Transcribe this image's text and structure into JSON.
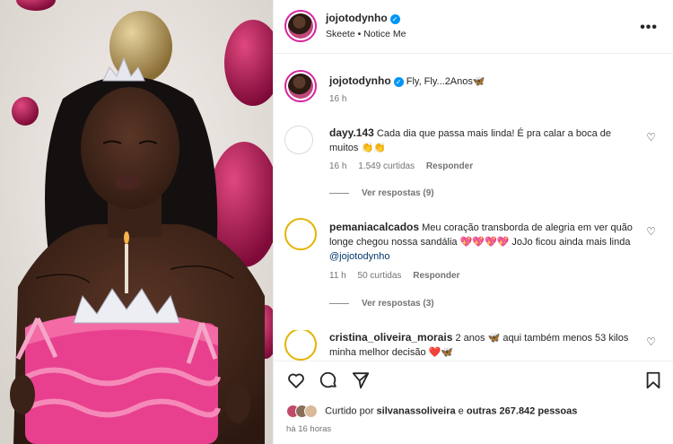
{
  "post": {
    "username": "jojotodynho",
    "audio": "Skeete • Notice Me",
    "caption": "Fly, Fly...2Anos🦋",
    "caption_time": "16 h",
    "more_icon": "more-horizontal-icon"
  },
  "comments": [
    {
      "username": "dayy.143",
      "text": "Cada dia que passa mais linda! É pra calar a boca de muitos 👏👏",
      "time": "16 h",
      "likes": "1.549 curtidas",
      "reply": "Responder",
      "view_replies": "Ver respostas (9)"
    },
    {
      "username": "pemaniacalcados",
      "text": "Meu coração transborda de alegria em ver quão longe chegou nossa sandália 💖💖💖💖 JoJo ficou ainda mais linda",
      "mention": "@jojotodynho",
      "time": "11 h",
      "likes": "50 curtidas",
      "reply": "Responder",
      "view_replies": "Ver respostas (3)"
    },
    {
      "username": "cristina_oliveira_morais",
      "text": "2 anos 🦋 aqui também menos 53 kilos minha melhor decisão ❤️🦋"
    }
  ],
  "footer": {
    "liked_prefix": "Curtido por",
    "liked_user": "silvanassoliveira",
    "liked_and": "e",
    "liked_others": "outras 267.842 pessoas",
    "time": "há 16 horas"
  },
  "colors": {
    "verified": "#0095f6",
    "story_ring": "#d6249f",
    "cake": "#e8408e",
    "balloon_pink": "#a3114d",
    "balloon_gold": "#b89858"
  }
}
